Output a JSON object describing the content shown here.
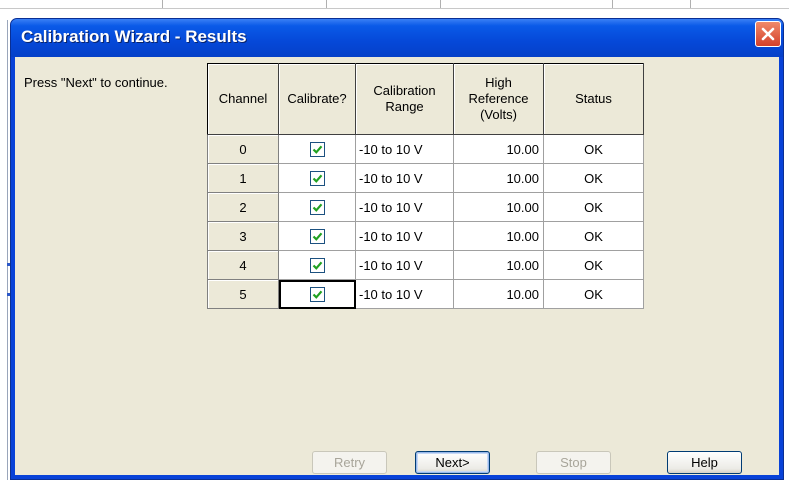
{
  "window": {
    "title": "Calibration Wizard - Results"
  },
  "prompt": "Press \"Next\" to continue.",
  "table": {
    "headers": {
      "channel": "Channel",
      "calibrate": "Calibrate?",
      "range_line1": "Calibration",
      "range_line2": "Range",
      "high_line1": "High",
      "high_line2": "Reference",
      "high_line3": "(Volts)",
      "status": "Status"
    },
    "rows": [
      {
        "channel": "0",
        "calibrate": true,
        "range": "-10 to 10 V",
        "high": "10.00",
        "status": "OK"
      },
      {
        "channel": "1",
        "calibrate": true,
        "range": "-10 to 10 V",
        "high": "10.00",
        "status": "OK"
      },
      {
        "channel": "2",
        "calibrate": true,
        "range": "-10 to 10 V",
        "high": "10.00",
        "status": "OK"
      },
      {
        "channel": "3",
        "calibrate": true,
        "range": "-10 to 10 V",
        "high": "10.00",
        "status": "OK"
      },
      {
        "channel": "4",
        "calibrate": true,
        "range": "-10 to 10 V",
        "high": "10.00",
        "status": "OK"
      },
      {
        "channel": "5",
        "calibrate": true,
        "range": "-10 to 10 V",
        "high": "10.00",
        "status": "OK"
      }
    ]
  },
  "buttons": {
    "retry": "Retry",
    "next": "Next>",
    "stop": "Stop",
    "help": "Help"
  },
  "icons": {
    "close": "close-icon",
    "check": "checkmark-icon"
  },
  "colors": {
    "titlebar": "#0548d8",
    "client_bg": "#ece9d8",
    "checkmark": "#21a121",
    "close_button": "#d4402a"
  }
}
